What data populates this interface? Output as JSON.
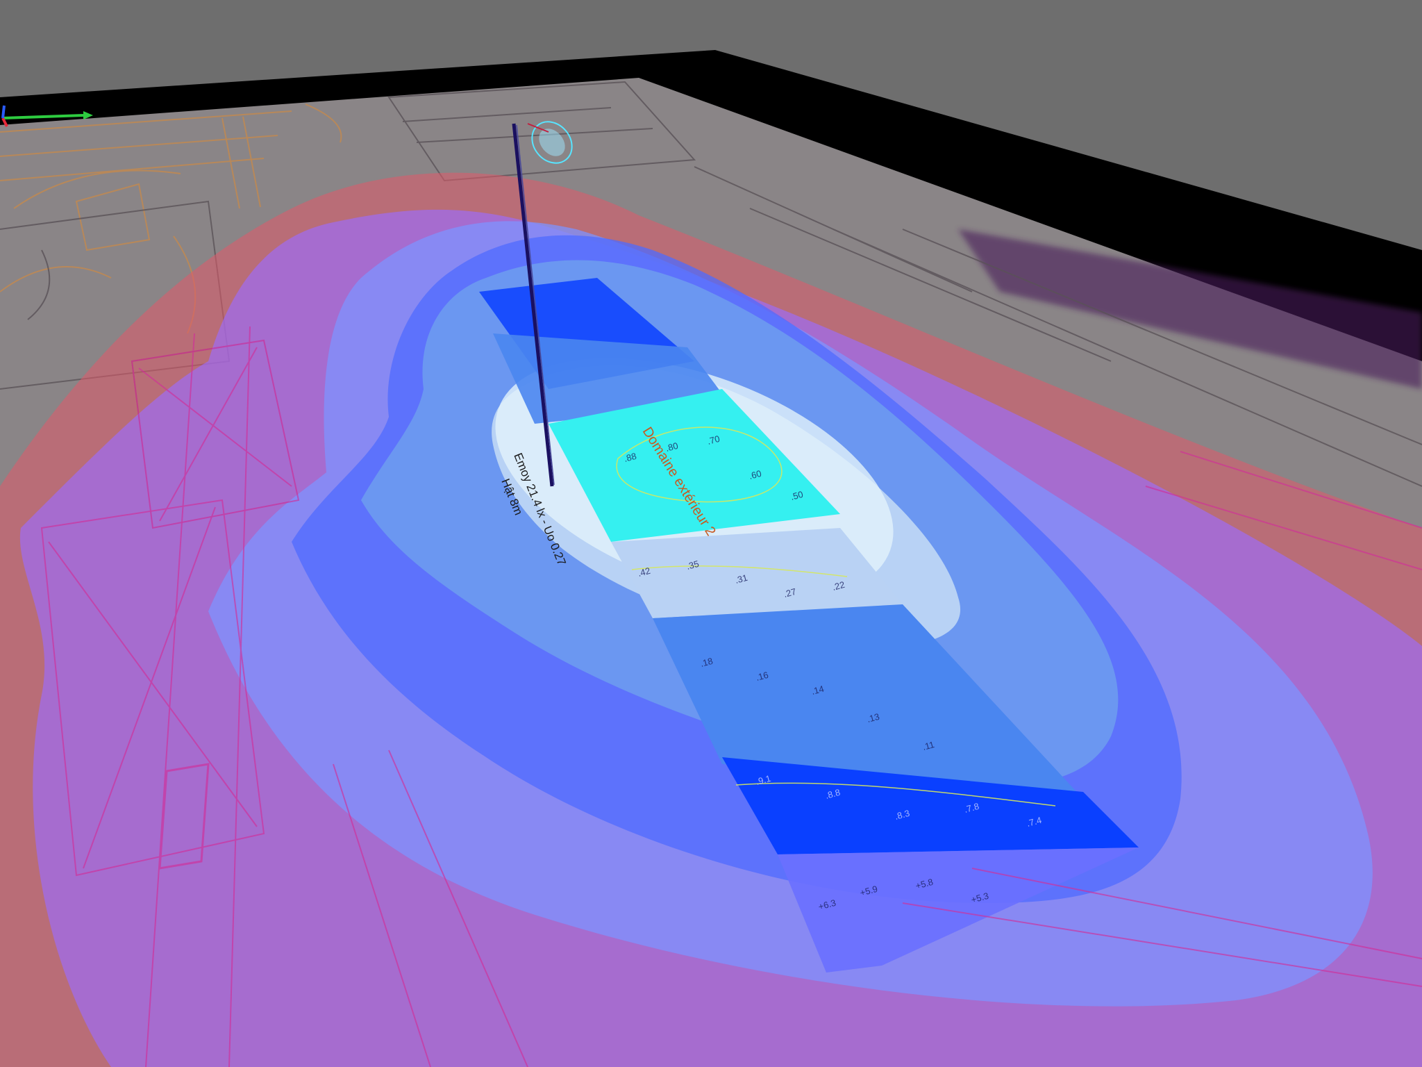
{
  "viewport": {
    "background_color": "#6e6e6e",
    "board_color": "#000000"
  },
  "luminaire": {
    "line1": "Emoy 21.4 lx - Uo 0.27",
    "line2": "Hật 8m"
  },
  "zone": {
    "label": "Domaine extérieur 2"
  },
  "isoline_colors": {
    "outer_red": "#e05a6a",
    "violet": "#9b6cff",
    "blue_light": "#7d93ff",
    "blue": "#4f6bff",
    "blue_deep": "#3355ff",
    "sky": "#8ec0f0",
    "pale": "#bcd4f4",
    "cyan": "#35f0f0",
    "grid_blue": "#0a40ff"
  },
  "grid_values": {
    "row_cyan": [
      ".88",
      ".80",
      ".70",
      ".60",
      ".50"
    ],
    "row_light": [
      ".42",
      ".35",
      ".31",
      ".27",
      ".22"
    ],
    "row_mid": [
      ".18",
      ".16",
      ".14",
      ".13",
      ".11"
    ],
    "row_deep": [
      ".9.1",
      ".8.8",
      ".8.3",
      ".7.8",
      ".7.4"
    ],
    "row_last": [
      "+6.3",
      "+5.9",
      "+5.8",
      "+5.3"
    ]
  },
  "axis": {
    "x_color": "#2ecc40",
    "y_color": "#e8283a",
    "z_color": "#2a5cff"
  }
}
